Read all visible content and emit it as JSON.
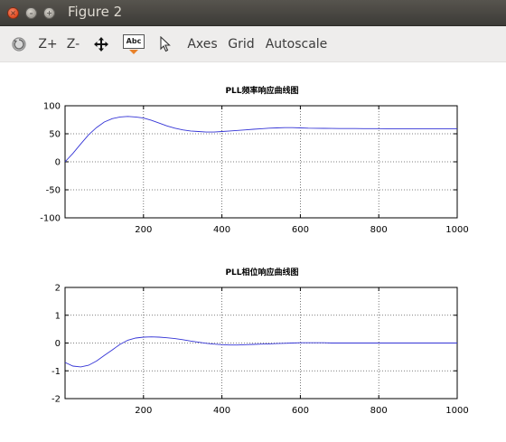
{
  "window": {
    "title": "Figure 2",
    "close_glyph": "×",
    "minimize_glyph": "–",
    "maximize_glyph": "+"
  },
  "toolbar": {
    "items": [
      {
        "name": "reset-view-button",
        "icon": "reset-icon"
      },
      {
        "name": "zoom-in-button",
        "label": "Z+"
      },
      {
        "name": "zoom-out-button",
        "label": "Z-"
      },
      {
        "name": "pan-button",
        "icon": "move-arrows-icon"
      },
      {
        "name": "text-tool-button",
        "icon": "abc-text-icon",
        "label": "Abc"
      },
      {
        "name": "select-button",
        "icon": "pointer-arrow-icon"
      },
      {
        "name": "axes-button",
        "label": "Axes"
      },
      {
        "name": "grid-button",
        "label": "Grid"
      },
      {
        "name": "autoscale-button",
        "label": "Autoscale"
      }
    ]
  },
  "colors": {
    "line": "#3434d6",
    "grid": "#555555"
  },
  "chart_data": [
    {
      "type": "line",
      "title": "PLL频率响应曲线图",
      "xlabel": "",
      "ylabel": "",
      "xlim": [
        0,
        1000
      ],
      "ylim": [
        -100,
        100
      ],
      "xticks": [
        200,
        400,
        600,
        800,
        1000
      ],
      "yticks": [
        -100,
        -50,
        0,
        50,
        100
      ],
      "grid": true,
      "series": [
        {
          "x": [
            0,
            20,
            40,
            60,
            80,
            100,
            120,
            140,
            160,
            180,
            200,
            220,
            240,
            260,
            280,
            300,
            320,
            340,
            360,
            380,
            400,
            420,
            440,
            460,
            480,
            500,
            520,
            540,
            560,
            580,
            600,
            620,
            640,
            660,
            680,
            700,
            720,
            740,
            760,
            780,
            800,
            820,
            840,
            860,
            880,
            900,
            920,
            940,
            960,
            980,
            1000
          ],
          "y": [
            0,
            15,
            32,
            48,
            61,
            71,
            77,
            80,
            81,
            80,
            78,
            74,
            69,
            64,
            60,
            57,
            55,
            54,
            53,
            53,
            54,
            55,
            56,
            57,
            58,
            59,
            60,
            60.5,
            61,
            61,
            60.5,
            60,
            59.8,
            59.6,
            59.5,
            59.4,
            59.3,
            59.3,
            59.2,
            59.2,
            59.2,
            59.1,
            59.1,
            59.1,
            59.0,
            59.0,
            59.0,
            59.0,
            59.0,
            59.0,
            59.0
          ]
        }
      ]
    },
    {
      "type": "line",
      "title": "PLL相位响应曲线图",
      "xlabel": "",
      "ylabel": "",
      "xlim": [
        0,
        1000
      ],
      "ylim": [
        -2,
        2
      ],
      "xticks": [
        200,
        400,
        600,
        800,
        1000
      ],
      "yticks": [
        -2,
        -1,
        0,
        1,
        2
      ],
      "grid": true,
      "series": [
        {
          "x": [
            0,
            20,
            40,
            60,
            80,
            100,
            120,
            140,
            160,
            180,
            200,
            220,
            240,
            260,
            280,
            300,
            320,
            340,
            360,
            380,
            400,
            420,
            440,
            460,
            480,
            500,
            520,
            540,
            560,
            580,
            600,
            620,
            640,
            660,
            680,
            700,
            720,
            740,
            760,
            780,
            800,
            820,
            840,
            860,
            880,
            900,
            920,
            940,
            960,
            980,
            1000
          ],
          "y": [
            -0.7,
            -0.83,
            -0.86,
            -0.8,
            -0.65,
            -0.45,
            -0.25,
            -0.05,
            0.1,
            0.18,
            0.21,
            0.22,
            0.21,
            0.19,
            0.16,
            0.12,
            0.07,
            0.03,
            -0.01,
            -0.04,
            -0.06,
            -0.07,
            -0.07,
            -0.06,
            -0.05,
            -0.04,
            -0.03,
            -0.02,
            -0.01,
            0.0,
            0.01,
            0.01,
            0.01,
            0.01,
            0.0,
            0.0,
            0.0,
            0.0,
            0.0,
            0.0,
            0.0,
            0.0,
            0.0,
            0.0,
            0.0,
            0.0,
            0.0,
            0.0,
            0.0,
            0.0,
            0.0
          ]
        }
      ]
    }
  ]
}
